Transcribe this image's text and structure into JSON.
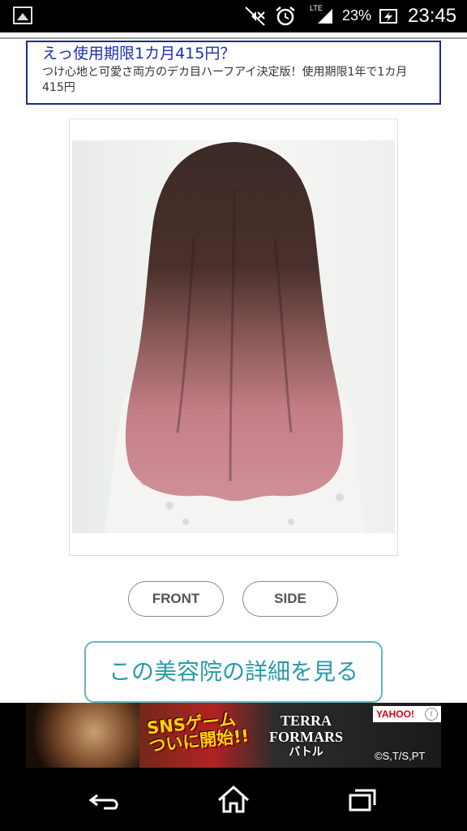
{
  "status_bar": {
    "lte_label": "LTE",
    "battery": "23%",
    "time": "23:45"
  },
  "ad": {
    "title": "えっ使用期限1カ月415円？",
    "body": "つけ心地と可愛さ両方のデカ目ハーフアイ決定版！使用期限1年で1カ月415円"
  },
  "view_buttons": {
    "front": "FRONT",
    "side": "SIDE"
  },
  "detail_button": "この美容院の詳細を見る",
  "banner": {
    "sns_line1": "SNSゲーム",
    "sns_line2": "ついに開始!!",
    "terra_line1": "TERRA",
    "terra_line2": "FORMARS",
    "terra_sub": "バトル",
    "yahoo": "YAHOO!",
    "info": "i",
    "copyright": "©S,T/S,PT"
  },
  "colors": {
    "ad_border": "#1e2a8c",
    "ad_title": "#1a2fb0",
    "detail_accent": "#2a9aa8",
    "hair_top": "#3b2a26",
    "hair_bottom": "#c98088"
  }
}
